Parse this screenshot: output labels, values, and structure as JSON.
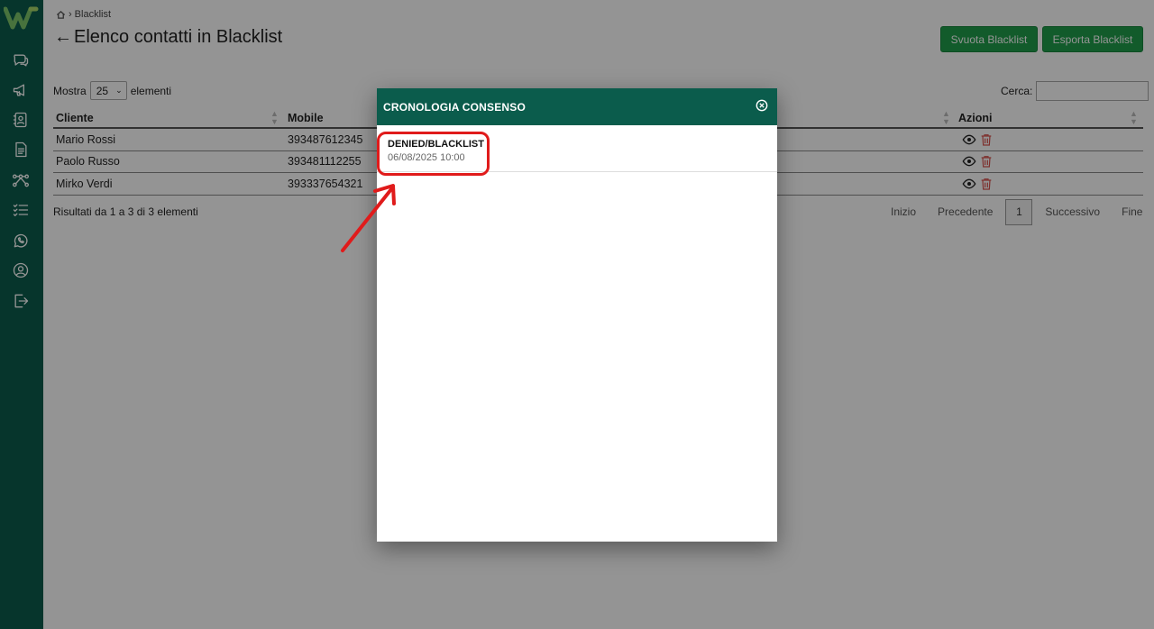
{
  "breadcrumb": {
    "current": "Blacklist"
  },
  "page": {
    "title": "Elenco contatti in Blacklist"
  },
  "buttons": {
    "svuota": "Svuota Blacklist",
    "esporta": "Esporta Blacklist"
  },
  "length": {
    "prefix": "Mostra",
    "value": "25",
    "suffix": "elementi"
  },
  "search": {
    "label": "Cerca:"
  },
  "table": {
    "headers": {
      "cliente": "Cliente",
      "mobile": "Mobile",
      "azioni": "Azioni"
    },
    "rows": [
      {
        "cliente": "Mario Rossi",
        "mobile": "393487612345"
      },
      {
        "cliente": "Paolo Russo",
        "mobile": "393481112255"
      },
      {
        "cliente": "Mirko Verdi",
        "mobile": "393337654321"
      }
    ]
  },
  "info": "Risultati da 1 a 3 di 3 elementi",
  "pager": {
    "first": "Inizio",
    "prev": "Precedente",
    "current": "1",
    "next": "Successivo",
    "last": "Fine"
  },
  "modal": {
    "title": "CRONOLOGIA CONSENSO",
    "entries": [
      {
        "status": "DENIED/BLACKLIST",
        "date": "06/08/2025 10:00"
      }
    ]
  },
  "colors": {
    "sidebar": "#0b5c4c",
    "button": "#1f9e4a",
    "highlight": "#e01b1b",
    "trash": "#d9534f"
  }
}
